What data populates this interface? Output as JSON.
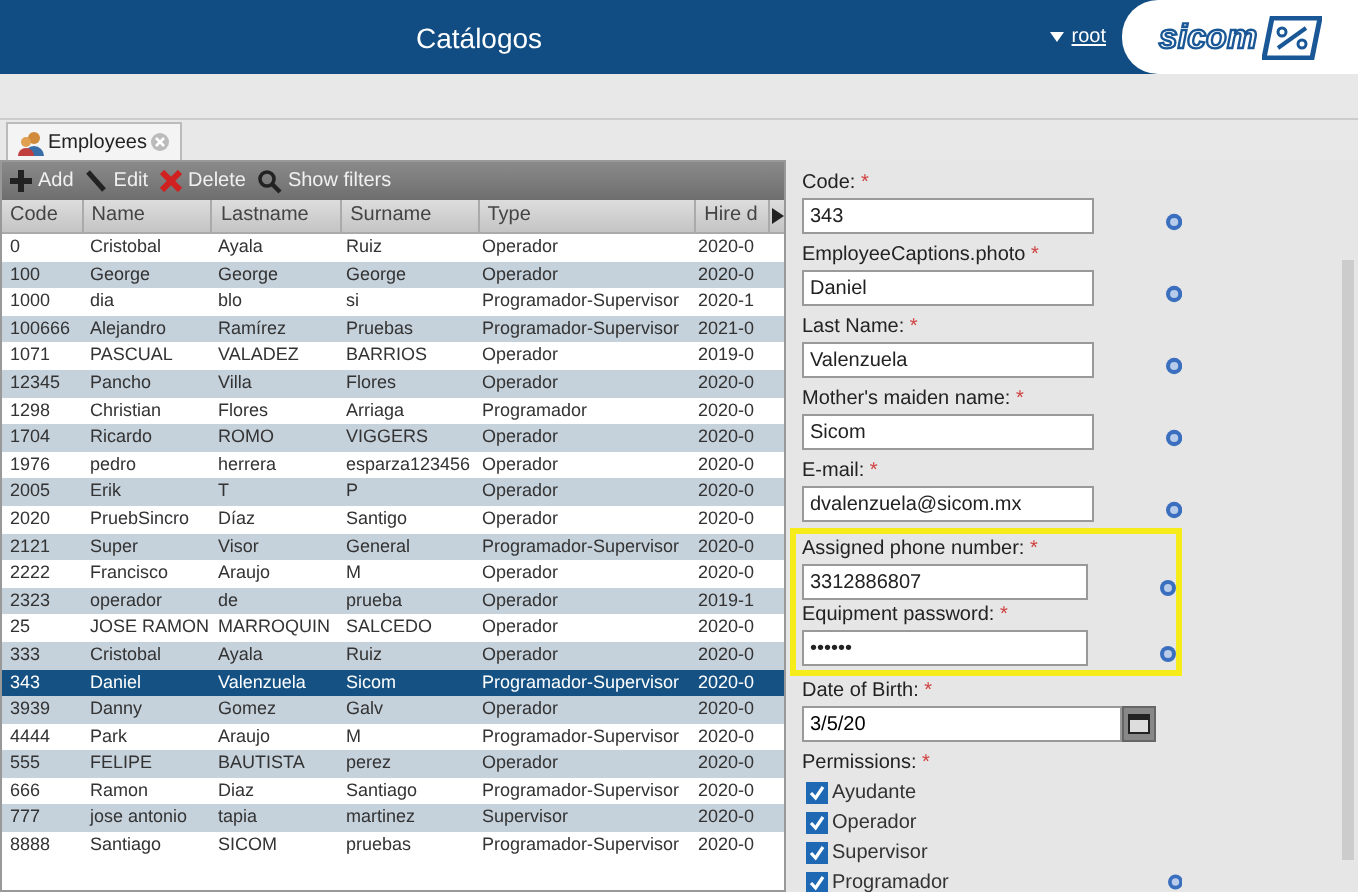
{
  "header": {
    "title": "Catálogos",
    "user": "root",
    "logo": "sicom"
  },
  "tabs": [
    {
      "label": "Employees",
      "selected": true
    }
  ],
  "toolbar": [
    "Add",
    "Edit",
    "Delete",
    "Show filters"
  ],
  "table": {
    "columns": [
      "Code",
      "Name",
      "Lastname",
      "Surname",
      "Type",
      "Hire d"
    ],
    "rows": [
      {
        "cells": [
          "0",
          "Cristobal",
          "Ayala",
          "Ruiz",
          "Operador",
          "2020-0"
        ],
        "selected": false
      },
      {
        "cells": [
          "100",
          "George",
          "George",
          "George",
          "Operador",
          "2020-0"
        ],
        "selected": false
      },
      {
        "cells": [
          "1000",
          "dia",
          "blo",
          "si",
          "Programador-Supervisor",
          "2020-1"
        ],
        "selected": false
      },
      {
        "cells": [
          "100666",
          "Alejandro",
          "Ramírez",
          "Pruebas",
          "Programador-Supervisor",
          "2021-0"
        ],
        "selected": false
      },
      {
        "cells": [
          "1071",
          "PASCUAL",
          "VALADEZ",
          "BARRIOS",
          "Operador",
          "2019-0"
        ],
        "selected": false
      },
      {
        "cells": [
          "12345",
          "Pancho",
          "Villa",
          "Flores",
          "Operador",
          "2020-0"
        ],
        "selected": false
      },
      {
        "cells": [
          "1298",
          "Christian",
          "Flores",
          "Arriaga",
          "Programador",
          "2020-0"
        ],
        "selected": false
      },
      {
        "cells": [
          "1704",
          "Ricardo",
          "ROMO",
          "VIGGERS",
          "Operador",
          "2020-0"
        ],
        "selected": false
      },
      {
        "cells": [
          "1976",
          "pedro",
          "herrera",
          "esparza123456",
          "Operador",
          "2020-0"
        ],
        "selected": false
      },
      {
        "cells": [
          "2005",
          "Erik",
          "T",
          "P",
          "Operador",
          "2020-0"
        ],
        "selected": false
      },
      {
        "cells": [
          "2020",
          "PruebSincro",
          "Díaz",
          "Santigo",
          "Operador",
          "2020-0"
        ],
        "selected": false
      },
      {
        "cells": [
          "2121",
          "Super",
          "Visor",
          "General",
          "Programador-Supervisor",
          "2020-0"
        ],
        "selected": false
      },
      {
        "cells": [
          "2222",
          "Francisco",
          "Araujo",
          "M",
          "Operador",
          "2020-0"
        ],
        "selected": false
      },
      {
        "cells": [
          "2323",
          "operador",
          "de",
          "prueba",
          "Operador",
          "2019-1"
        ],
        "selected": false
      },
      {
        "cells": [
          "25",
          "JOSE RAMON",
          "MARROQUIN",
          "SALCEDO",
          "Operador",
          "2020-0"
        ],
        "selected": false
      },
      {
        "cells": [
          "333",
          "Cristobal",
          "Ayala",
          "Ruiz",
          "Operador",
          "2020-0"
        ],
        "selected": false
      },
      {
        "cells": [
          "343",
          "Daniel",
          "Valenzuela",
          "Sicom",
          "Programador-Supervisor",
          "2020-0"
        ],
        "selected": true
      },
      {
        "cells": [
          "3939",
          "Danny",
          "Gomez",
          "Galv",
          "Operador",
          "2020-0"
        ],
        "selected": false
      },
      {
        "cells": [
          "4444",
          "Park",
          "Araujo",
          "M",
          "Programador-Supervisor",
          "2020-0"
        ],
        "selected": false
      },
      {
        "cells": [
          "555",
          "FELIPE",
          "BAUTISTA",
          "perez",
          "Operador",
          "2020-0"
        ],
        "selected": false
      },
      {
        "cells": [
          "666",
          "Ramon",
          "Diaz",
          "Santiago",
          "Programador-Supervisor",
          "2020-0"
        ],
        "selected": false
      },
      {
        "cells": [
          "777",
          "jose antonio",
          "tapia",
          "martinez",
          "Supervisor",
          "2020-0"
        ],
        "selected": false
      },
      {
        "cells": [
          "8888",
          "Santiago",
          "SICOM",
          "pruebas",
          "Programador-Supervisor",
          "2020-0"
        ],
        "selected": false
      }
    ]
  },
  "form": {
    "fields": [
      {
        "kind": "text",
        "label": "Code:",
        "mark": "*",
        "value": "343",
        "highlighted": false
      },
      {
        "kind": "text",
        "label": "EmployeeCaptions.photo",
        "mark": "*",
        "value": "Daniel",
        "highlighted": false
      },
      {
        "kind": "text",
        "label": "Last Name:",
        "mark": "*",
        "value": "Valenzuela",
        "highlighted": false
      },
      {
        "kind": "text",
        "label": "Mother's maiden name:",
        "mark": "*",
        "value": "Sicom",
        "highlighted": false
      },
      {
        "kind": "text",
        "label": "E-mail:",
        "mark": "*",
        "value": "dvalenzuela@sicom.mx",
        "highlighted": false
      },
      {
        "kind": "text",
        "label": "Assigned phone number:",
        "mark": "*",
        "value": "3312886807",
        "highlighted": true
      },
      {
        "kind": "text",
        "label": "Equipment password:",
        "mark": "*",
        "value": "••••••",
        "highlighted": true
      },
      {
        "kind": "date",
        "label": "Date of Birth:",
        "mark": "*",
        "value": "3/5/20",
        "highlighted": false
      },
      {
        "kind": "checks",
        "label": "Permissions:",
        "mark": "*",
        "highlighted": false,
        "options": [
          {
            "label": "Ayudante",
            "checked": true
          },
          {
            "label": "Operador",
            "checked": true
          },
          {
            "label": "Supervisor",
            "checked": true
          },
          {
            "label": "Programador",
            "checked": true
          }
        ]
      }
    ]
  }
}
